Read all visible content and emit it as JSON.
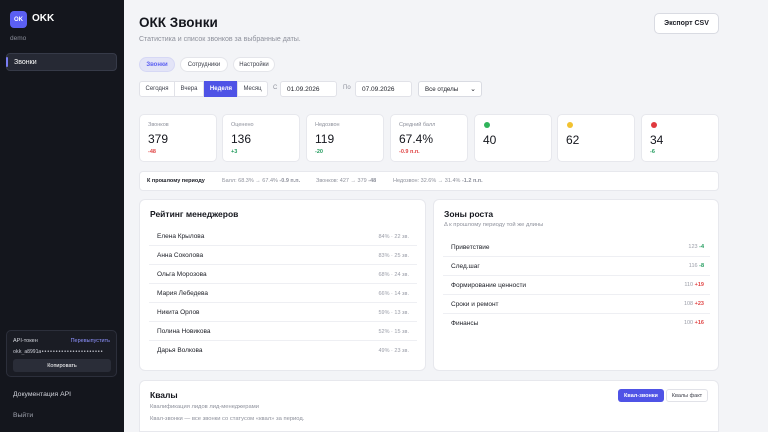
{
  "app": {
    "logo_text": "OK",
    "name": "OKK",
    "account": "demo"
  },
  "sidebar": {
    "nav": [
      {
        "label": "Звонки",
        "active": true
      }
    ],
    "api": {
      "title": "API-токен",
      "regen_label": "Перевыпустить",
      "token": "okk_a8991a••••••••••••••••••••••",
      "copy_label": "Копировать"
    },
    "docs_label": "Документация API",
    "logout_label": "Выйти"
  },
  "header": {
    "title": "ОКК Звонки",
    "subtitle": "Статистика и список звонков за выбранные даты.",
    "export_label": "Экспорт CSV"
  },
  "tabs": [
    {
      "label": "Звонки",
      "active": true
    },
    {
      "label": "Сотрудники",
      "active": false
    },
    {
      "label": "Настройки",
      "active": false
    }
  ],
  "filters": {
    "periods": [
      {
        "label": "Сегодня",
        "active": false
      },
      {
        "label": "Вчера",
        "active": false
      },
      {
        "label": "Неделя",
        "active": true
      },
      {
        "label": "Месяц",
        "active": false
      }
    ],
    "from_label": "С",
    "from_date": "01.09.2026",
    "to_label": "По",
    "to_date": "07.09.2026",
    "department": "Все отделы"
  },
  "kpis": [
    {
      "label": "Звонков",
      "value": "379",
      "delta": "-48",
      "trend": "neg"
    },
    {
      "label": "Оценено",
      "value": "136",
      "delta": "+3",
      "trend": "pos"
    },
    {
      "label": "Недозвон",
      "value": "119",
      "delta": "-20",
      "trend": "pos"
    },
    {
      "label": "Средний балл",
      "value": "67.4%",
      "delta": "-0.9 п.п.",
      "trend": "neg"
    }
  ],
  "score_groups": [
    {
      "color": "#2fb35a",
      "value": "40",
      "delta": ""
    },
    {
      "color": "#f2c230",
      "value": "62",
      "delta": ""
    },
    {
      "color": "#e0393e",
      "value": "34",
      "delta": "-6",
      "trend": "pos"
    }
  ],
  "comparison": {
    "label": "К прошлому периоду",
    "items": [
      {
        "text": "Балл: 68.3% → 67.4%",
        "delta": "-0.9 п.п.",
        "trend": "neg"
      },
      {
        "text": "Звонков: 427 → 379",
        "delta": "-48",
        "trend": "neg"
      },
      {
        "text": "Недозвон: 32.6% → 31.4%",
        "delta": "-1.2 п.п.",
        "trend": "pos"
      }
    ]
  },
  "managers": {
    "title": "Рейтинг менеджеров",
    "rows": [
      {
        "name": "Елена Крылова",
        "stat": "84% · 22 зв."
      },
      {
        "name": "Анна Соколова",
        "stat": "83% · 25 зв."
      },
      {
        "name": "Ольга Морозова",
        "stat": "68% · 24 зв."
      },
      {
        "name": "Мария Лебедева",
        "stat": "66% · 14 зв."
      },
      {
        "name": "Никита Орлов",
        "stat": "59% · 13 зв."
      },
      {
        "name": "Полина Новикова",
        "stat": "52% · 15 зв."
      },
      {
        "name": "Дарья Волкова",
        "stat": "49% · 23 зв."
      }
    ]
  },
  "growth": {
    "title": "Зоны роста",
    "subtitle": "Δ к прошлому периоду той же длины",
    "rows": [
      {
        "name": "Приветствие",
        "count": "123",
        "delta": "-4",
        "trend": "pos"
      },
      {
        "name": "След.шаг",
        "count": "116",
        "delta": "-8",
        "trend": "pos"
      },
      {
        "name": "Формирование ценности",
        "count": "110",
        "delta": "+19",
        "trend": "neg"
      },
      {
        "name": "Сроки и ремонт",
        "count": "108",
        "delta": "+23",
        "trend": "neg"
      },
      {
        "name": "Финансы",
        "count": "100",
        "delta": "+16",
        "trend": "neg"
      }
    ]
  },
  "kvaly": {
    "title": "Квалы",
    "subtitle": "Квалификация лидов лид-менеджерами",
    "note": "Квал-звонки — все звонки со статусом «квал» за период.",
    "tabs": [
      {
        "label": "Квал-звонки",
        "active": true
      },
      {
        "label": "Квалы факт",
        "active": false
      }
    ]
  },
  "colors": {
    "accent": "#4f53e6",
    "negative": "#e04646",
    "positive": "#1f9a5b",
    "sidebar": "#14161d"
  }
}
